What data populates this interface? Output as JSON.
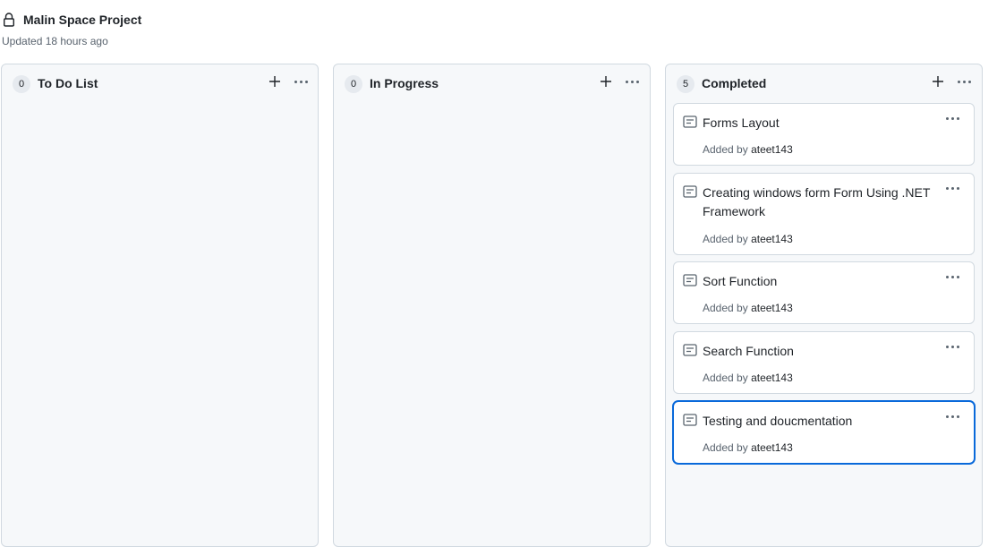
{
  "project": {
    "title": "Malin Space Project",
    "updated": "Updated 18 hours ago",
    "icon": "lock-icon"
  },
  "columns": [
    {
      "count": "0",
      "title": "To Do List",
      "cards": []
    },
    {
      "count": "0",
      "title": "In Progress",
      "cards": []
    },
    {
      "count": "5",
      "title": "Completed",
      "cards": [
        {
          "title": "Forms Layout",
          "added_by_label": "Added by",
          "author": "ateet143"
        },
        {
          "title": "Creating windows form Form Using .NET Framework",
          "added_by_label": "Added by",
          "author": "ateet143"
        },
        {
          "title": "Sort Function",
          "added_by_label": "Added by",
          "author": "ateet143"
        },
        {
          "title": "Search Function",
          "added_by_label": "Added by",
          "author": "ateet143"
        },
        {
          "title": "Testing and doucmentation",
          "added_by_label": "Added by",
          "author": "ateet143"
        }
      ]
    }
  ],
  "icons": {
    "add": "plus-icon",
    "more": "kebab-horizontal-icon",
    "note": "note-icon"
  },
  "colors": {
    "selected_border": "#0969da",
    "column_bg": "#f6f8fa",
    "muted_text": "#59636e"
  }
}
